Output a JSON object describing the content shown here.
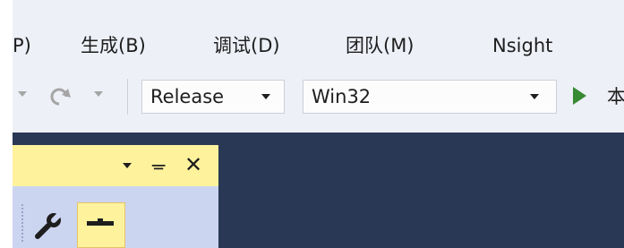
{
  "menu": {
    "items": [
      {
        "label": "P)"
      },
      {
        "label": "生成(B)"
      },
      {
        "label": "调试(D)"
      },
      {
        "label": "团队(M)"
      },
      {
        "label": "Nsight"
      }
    ]
  },
  "toolbar": {
    "configuration": "Release",
    "platform": "Win32",
    "run_label": "本"
  },
  "tool_window": {
    "pin_glyph": "ᚚ",
    "close_glyph": "✕"
  },
  "icons": [
    "redo-icon",
    "play-icon",
    "wrench-icon",
    "pin-icon",
    "close-icon"
  ],
  "colors": {
    "chrome": "#eef0f8",
    "editor_bg": "#293955",
    "tool_window_bg": "#ccd5f0",
    "active_title": "#fff29d",
    "play_green": "#388a34"
  }
}
